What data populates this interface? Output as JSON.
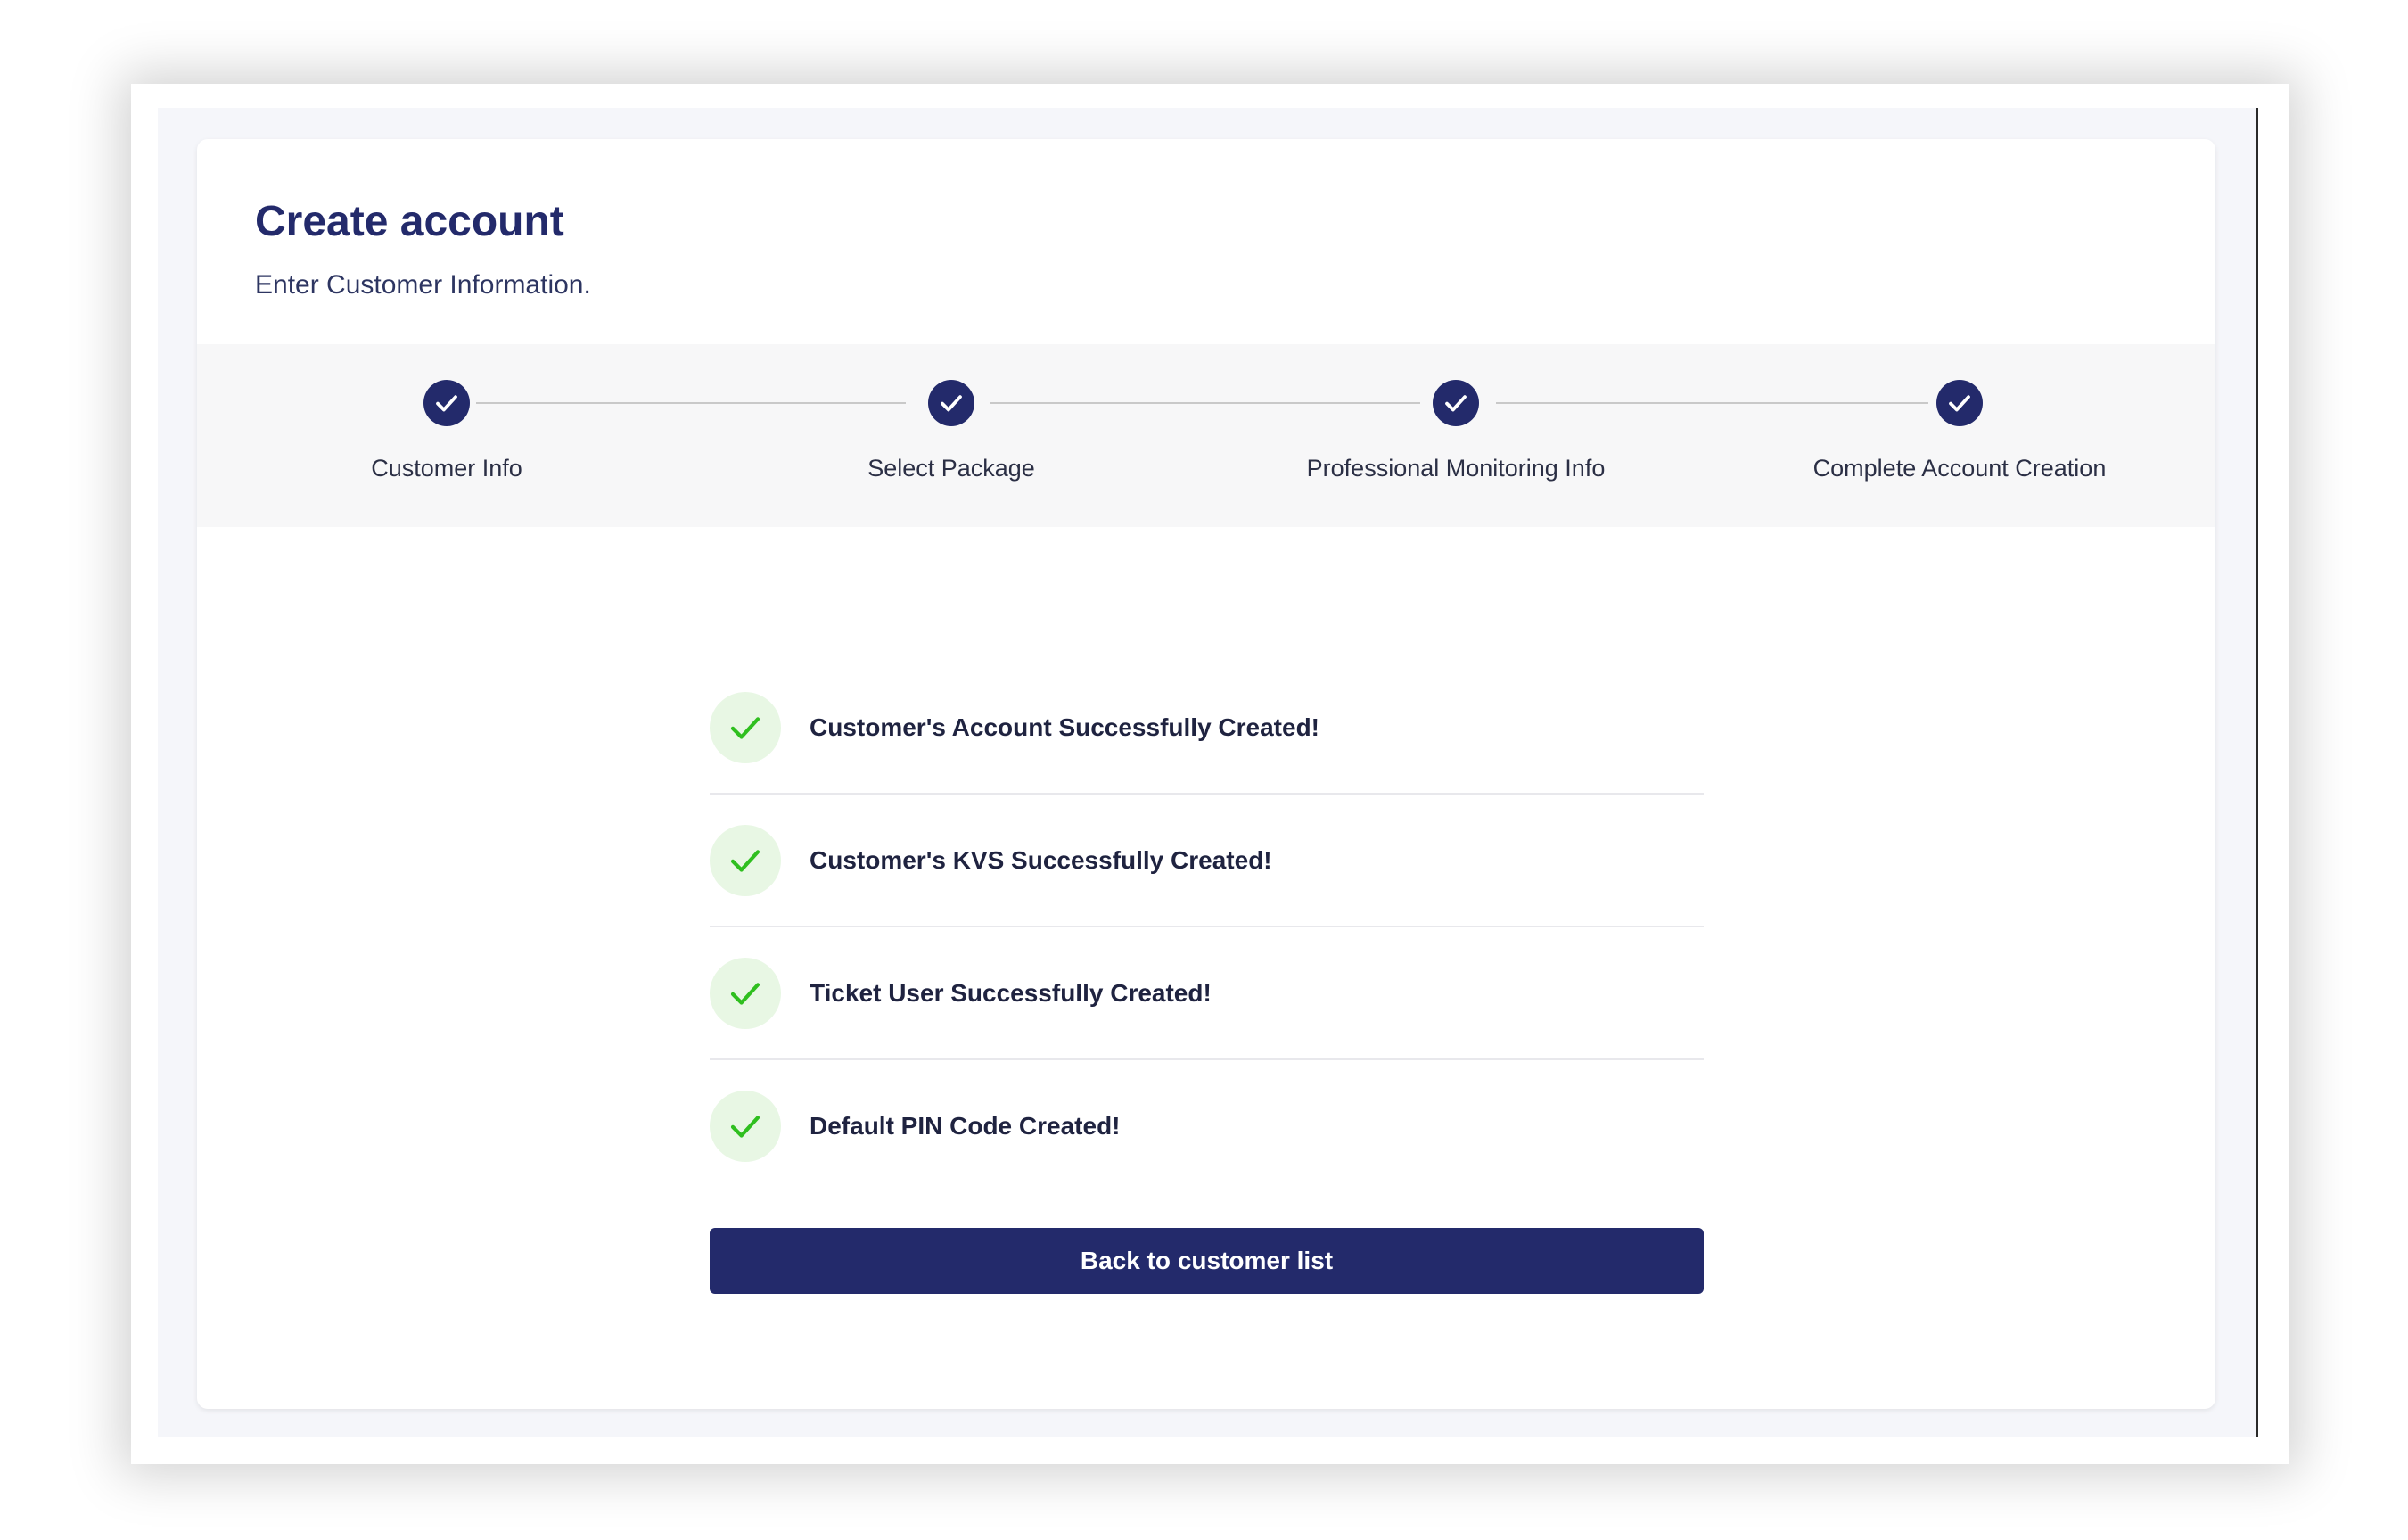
{
  "header": {
    "title": "Create account",
    "subtitle": "Enter Customer Information."
  },
  "stepper": {
    "steps": [
      {
        "label": "Customer Info",
        "status": "completed",
        "icon": "check-icon"
      },
      {
        "label": "Select Package",
        "status": "completed",
        "icon": "check-icon"
      },
      {
        "label": "Professional Monitoring Info",
        "status": "completed",
        "icon": "check-icon"
      },
      {
        "label": "Complete Account Creation",
        "status": "completed",
        "icon": "check-icon"
      }
    ]
  },
  "results": [
    {
      "text": "Customer's Account Successfully Created!",
      "icon": "check-icon"
    },
    {
      "text": "Customer's KVS Successfully Created!",
      "icon": "check-icon"
    },
    {
      "text": "Ticket User Successfully Created!",
      "icon": "check-icon"
    },
    {
      "text": "Default PIN Code Created!",
      "icon": "check-icon"
    }
  ],
  "actions": {
    "back_label": "Back to customer list"
  },
  "colors": {
    "primary": "#232a6b",
    "success_check": "#2fbf1f",
    "success_bg": "#e8f7e4",
    "stepper_bg": "#f7f7f8"
  }
}
